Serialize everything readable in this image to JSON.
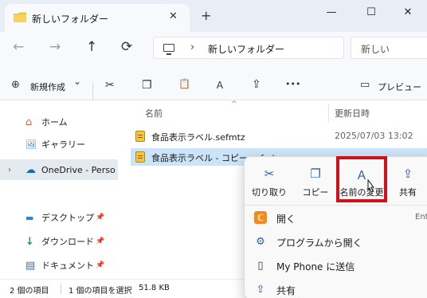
{
  "window": {
    "tab_title": "新しいフォルダー",
    "close_glyph": "✕",
    "new_tab_glyph": "+",
    "minimize_glyph": "—",
    "maximize_glyph": "☐",
    "close_window_glyph": "✕"
  },
  "address": {
    "back_glyph": "←",
    "forward_glyph": "→",
    "up_glyph": "↑",
    "refresh_glyph": "⟳",
    "chevron": "›",
    "path": "新しいフォルダー",
    "search_placeholder": "新しい"
  },
  "toolbar": {
    "new_icon": "⊕",
    "new_label": "新規作成",
    "new_caret": "⌄",
    "cut_glyph": "✂",
    "copy_glyph": "❐",
    "paste_glyph": "📋",
    "rename_glyph": "Ａ",
    "share_glyph": "⇪",
    "more_glyph": "•••",
    "preview_icon": "▭",
    "preview_label": "プレビュー"
  },
  "nav": {
    "items": [
      {
        "label": "ホーム",
        "icon": "⌂"
      },
      {
        "label": "ギャラリー",
        "icon": "🖼"
      },
      {
        "label": "OneDrive - Perso",
        "icon": "☁",
        "expander": "›"
      },
      {
        "label": "デスクトップ",
        "icon": "▬",
        "pin": "📌"
      },
      {
        "label": "ダウンロード",
        "icon": "↓",
        "pin": "📌"
      },
      {
        "label": "ドキュメント",
        "icon": "▤",
        "pin": "📌"
      }
    ]
  },
  "filelist": {
    "col_name": "名前",
    "col_date": "更新日時",
    "sort_caret": "^",
    "rows": [
      {
        "name": "食品表示ラベル.sefmtz",
        "date": "2025/07/03 13:02"
      },
      {
        "name": "食品表示ラベル - コピー.sefmtz",
        "date": ""
      }
    ]
  },
  "status": {
    "count": "2 個の項目",
    "selected": "1 個の項目を選択",
    "size": "51.8 KB"
  },
  "context_menu": {
    "top_buttons": [
      {
        "label": "切り取り",
        "icon": "✂"
      },
      {
        "label": "コピー",
        "icon": "❐"
      },
      {
        "label": "名前の変更",
        "icon": "Ａ"
      },
      {
        "label": "共有",
        "icon": "⇪"
      }
    ],
    "items": [
      {
        "label": "開く",
        "icon": "ℂ",
        "shortcut": "Ent"
      },
      {
        "label": "プログラムから開く",
        "icon": "⚙"
      },
      {
        "label": "My Phone に送信",
        "icon": "▯"
      },
      {
        "label": "共有",
        "icon": "⇪"
      }
    ]
  },
  "colors": {
    "highlight": "#d0101a",
    "selection": "#cce4f7",
    "accent": "#2d5fa5"
  }
}
